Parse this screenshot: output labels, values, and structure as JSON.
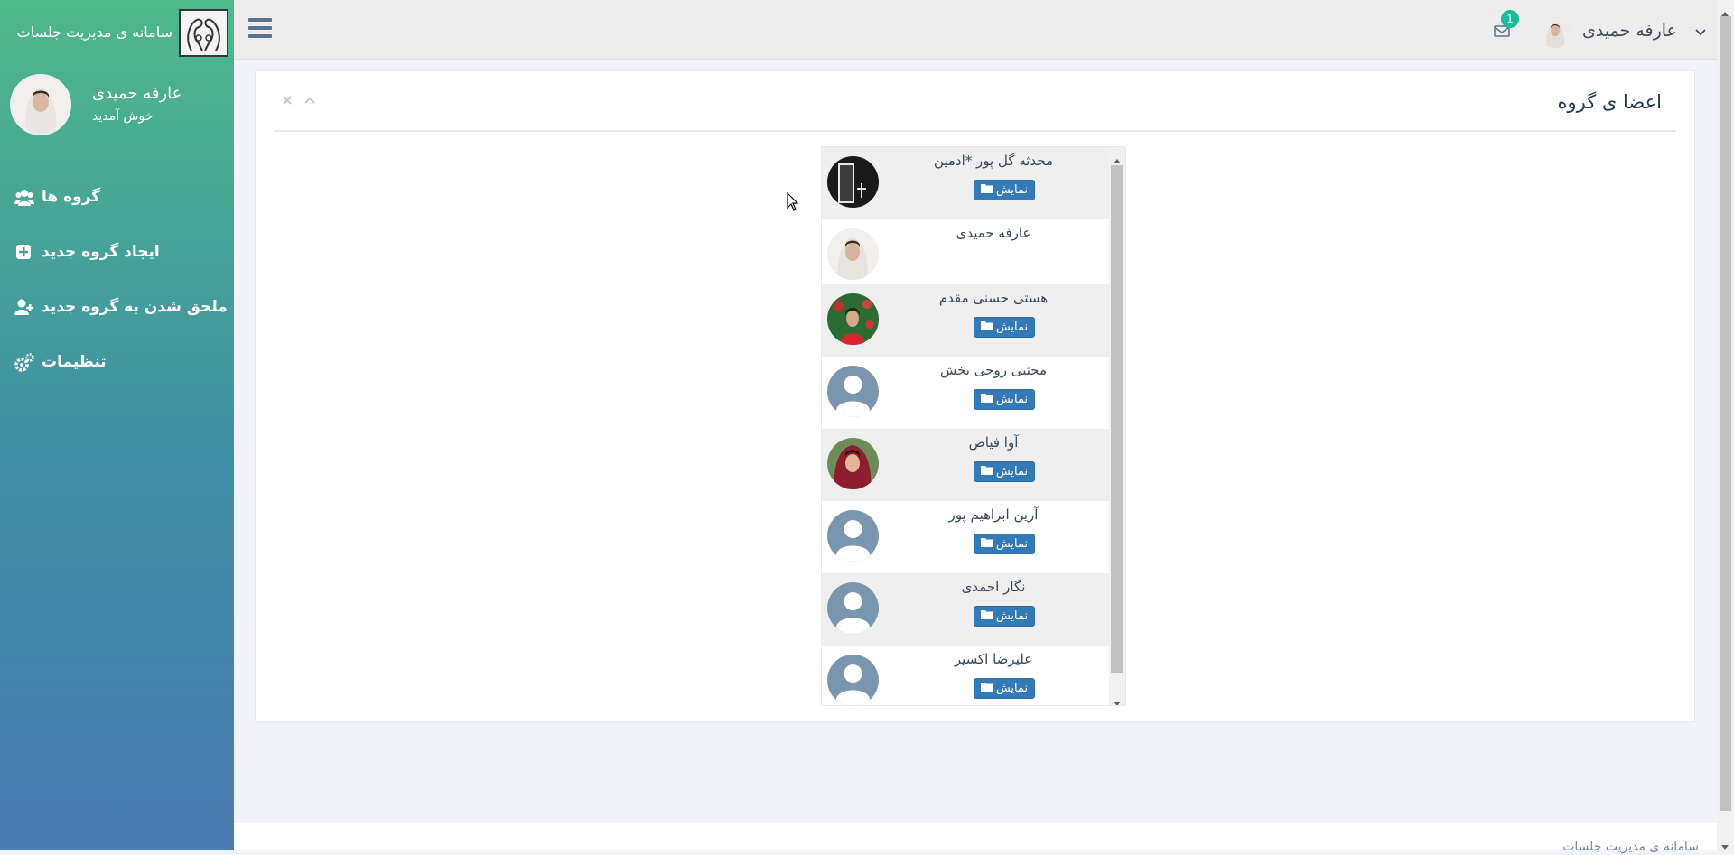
{
  "brand": {
    "title": "سامانه ی مدیریت جلسات",
    "logo_icon": "swan-logo-icon"
  },
  "profile": {
    "name": "عارفه حمیدی",
    "welcome": "خوش آمدید"
  },
  "nav": [
    {
      "label": "گروه ها",
      "icon": "users-icon"
    },
    {
      "label": "ایجاد گروه جدید",
      "icon": "plus-square-icon"
    },
    {
      "label": "ملحق شدن به گروه جدید",
      "icon": "user-plus-icon"
    },
    {
      "label": "تنظیمات",
      "icon": "gears-icon"
    }
  ],
  "topbar": {
    "user_name": "عارفه حمیدی",
    "mail_badge": "1"
  },
  "panel": {
    "title": "اعضا ی گروه"
  },
  "members": [
    {
      "name": "محدثه گل پور *ادمین",
      "button": "نمایش",
      "avatar": "photo-dark"
    },
    {
      "name": "عارفه حمیدی",
      "button": "",
      "avatar": "photo-light"
    },
    {
      "name": "هستی حسنی مقدم",
      "button": "نمایش",
      "avatar": "photo-red"
    },
    {
      "name": "مجتبی روحی بخش",
      "button": "نمایش",
      "avatar": "default"
    },
    {
      "name": "آوا فیاض",
      "button": "نمایش",
      "avatar": "photo-scarf"
    },
    {
      "name": "آرین ابراهیم پور",
      "button": "نمایش",
      "avatar": "default"
    },
    {
      "name": "نگار احمدی",
      "button": "نمایش",
      "avatar": "default"
    },
    {
      "name": "علیرضا اکسیر",
      "button": "نمایش",
      "avatar": "default"
    }
  ],
  "footer": {
    "text": "سامانه ی مدیریت جلسات"
  },
  "colors": {
    "sidebar_top": "#4fb889",
    "sidebar_bottom": "#4a7bb3",
    "button": "#337ab7",
    "badge": "#1abb9c"
  }
}
